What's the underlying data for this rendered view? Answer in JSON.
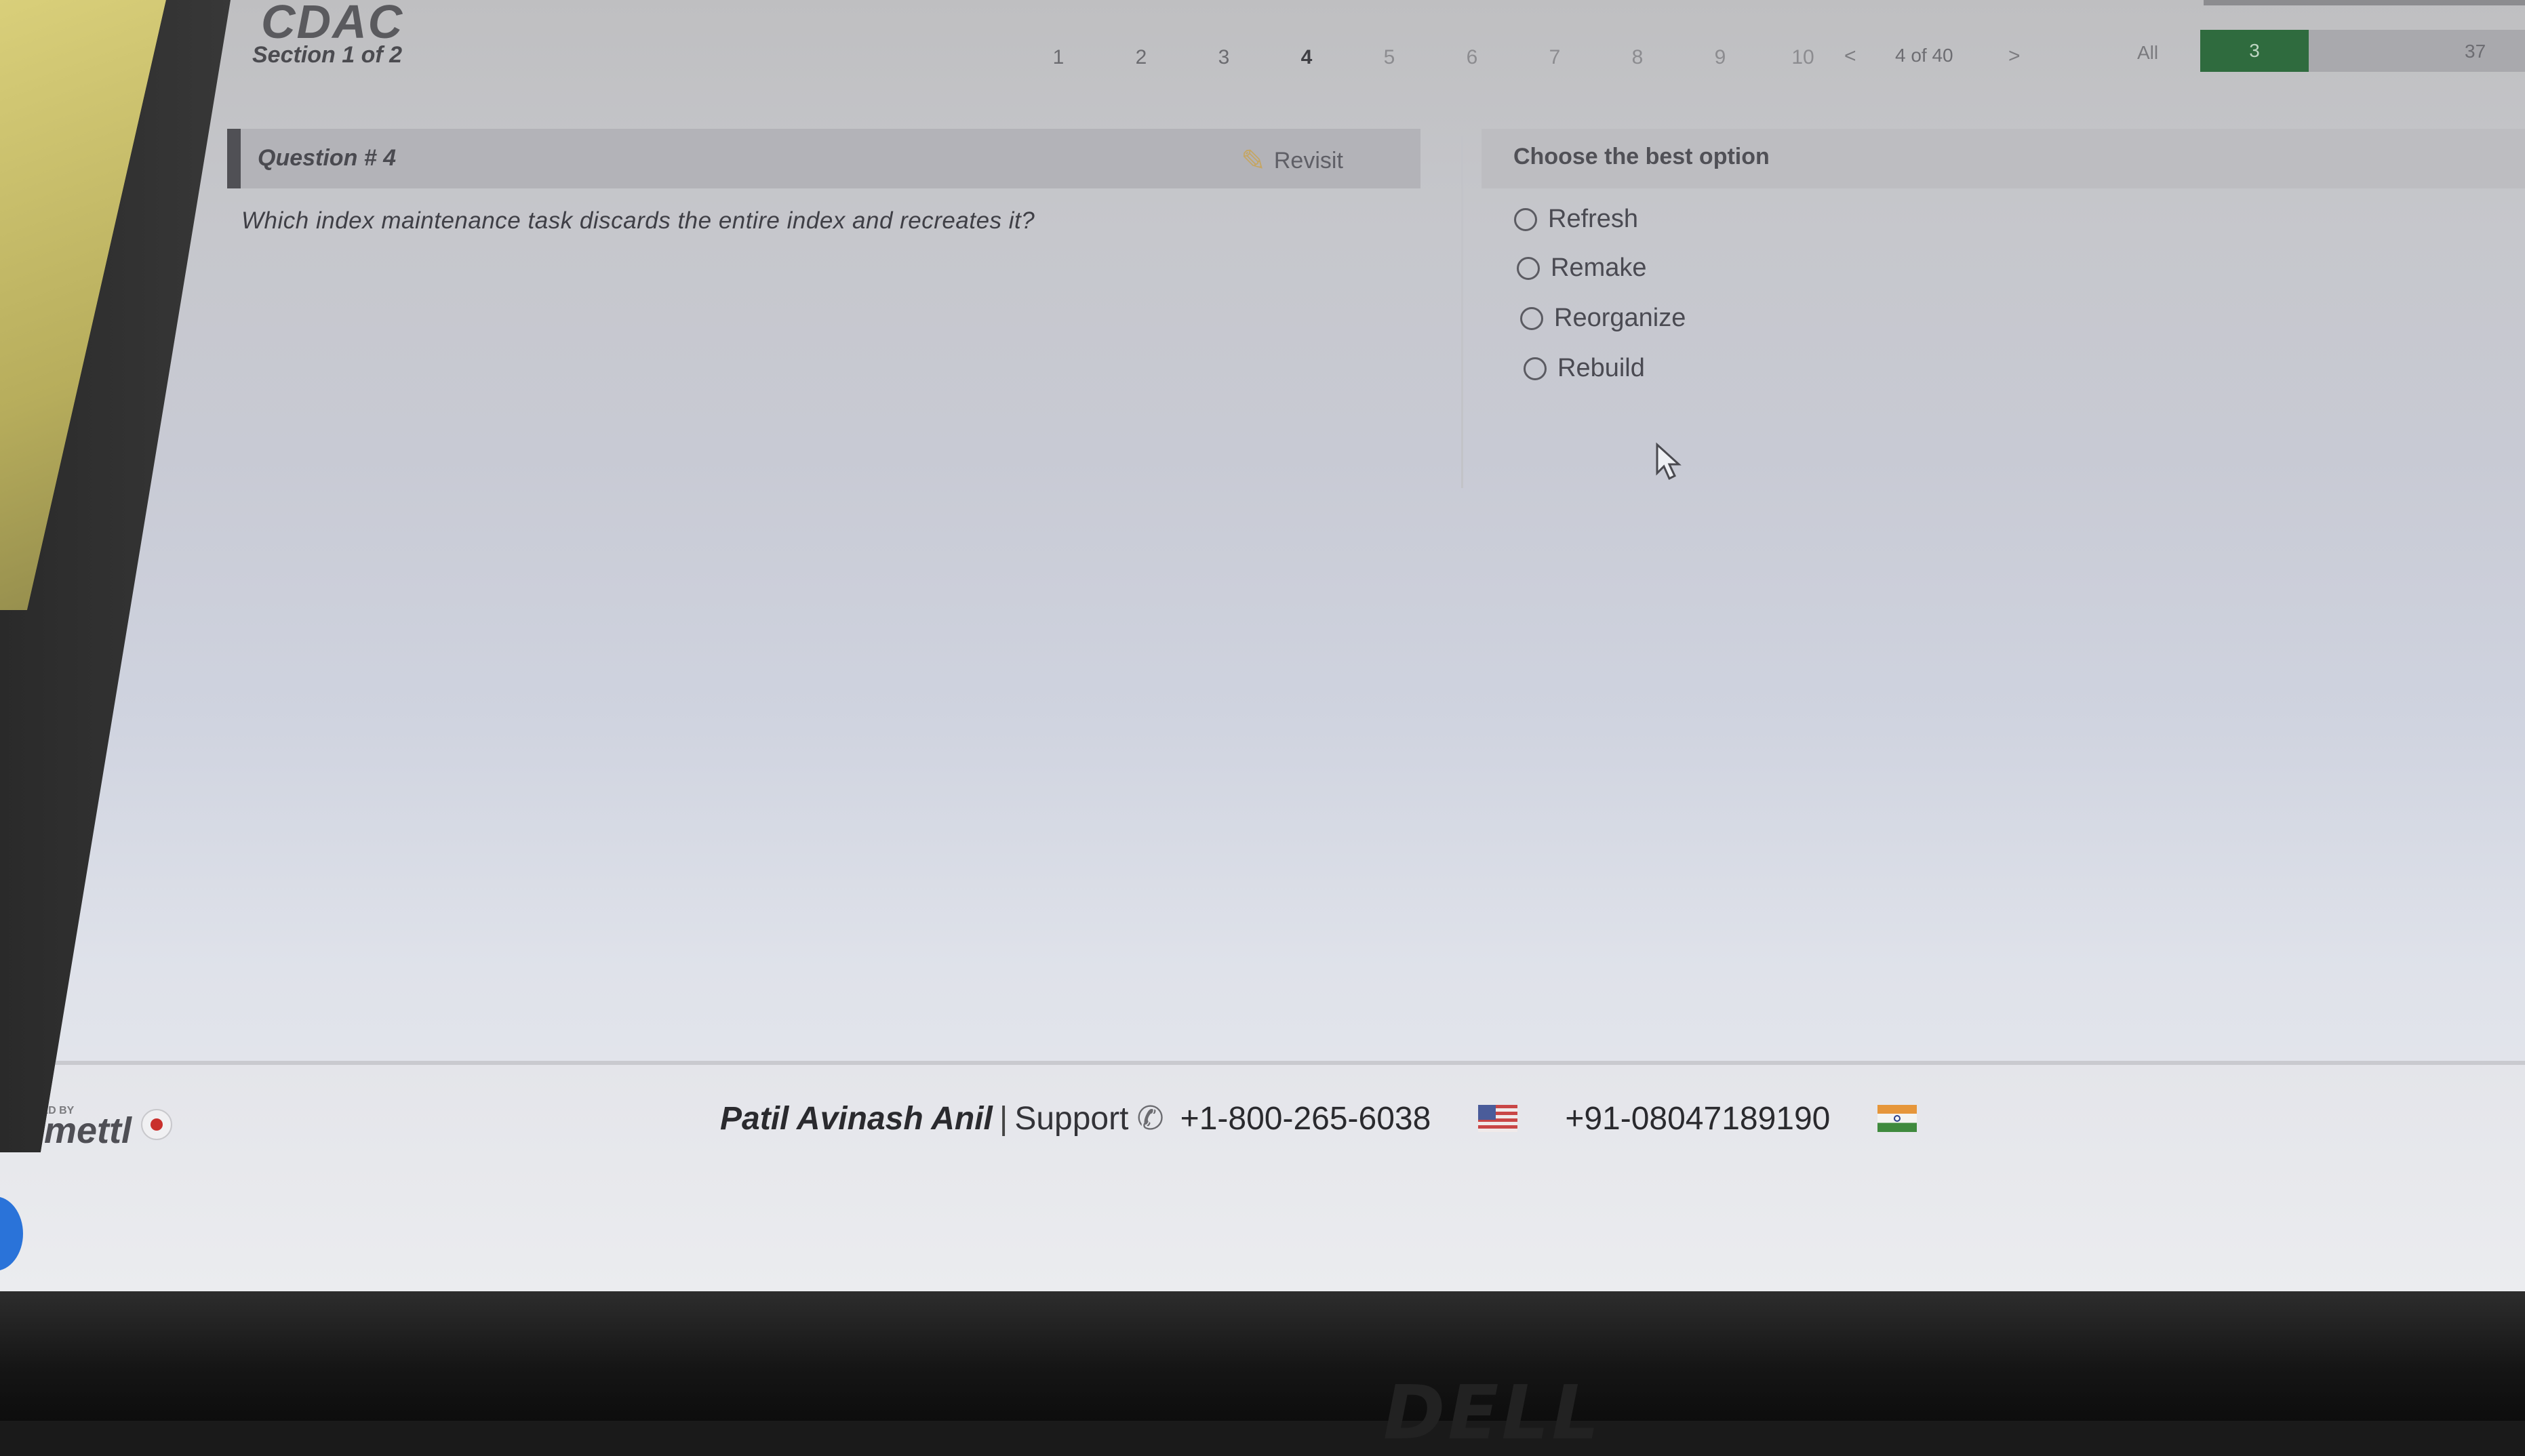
{
  "header": {
    "brand": "CDAC",
    "section_label": "Section 1 of 2",
    "question_nav": [
      "1",
      "2",
      "3",
      "4",
      "5",
      "6",
      "7",
      "8",
      "9",
      "10"
    ],
    "current_question": "4",
    "prev_arrow": "<",
    "next_arrow": ">",
    "page_indicator": "4 of 40",
    "filter_label": "All",
    "answered_count": "3",
    "remaining_count": "37"
  },
  "question": {
    "number_label": "Question # 4",
    "revisit_label": "Revisit",
    "text": "Which index maintenance task discards the entire index and recreates it?"
  },
  "options_panel": {
    "title": "Choose the best option",
    "options": [
      "Refresh",
      "Remake",
      "Reorganize",
      "Rebuild"
    ]
  },
  "footer": {
    "powered_by": "POWERED BY",
    "logo_text": "mettl",
    "candidate_name": "Patil Avinash Anil",
    "separator": "|",
    "support_label": "Support",
    "us_phone": "+1-800-265-6038",
    "in_phone": "+91-08047189190"
  },
  "hardware": {
    "laptop_logo": "DELL"
  },
  "colors": {
    "answered_green": "#2f6b3e",
    "record_red": "#c9302c",
    "chat_blue": "#2a73d9"
  }
}
